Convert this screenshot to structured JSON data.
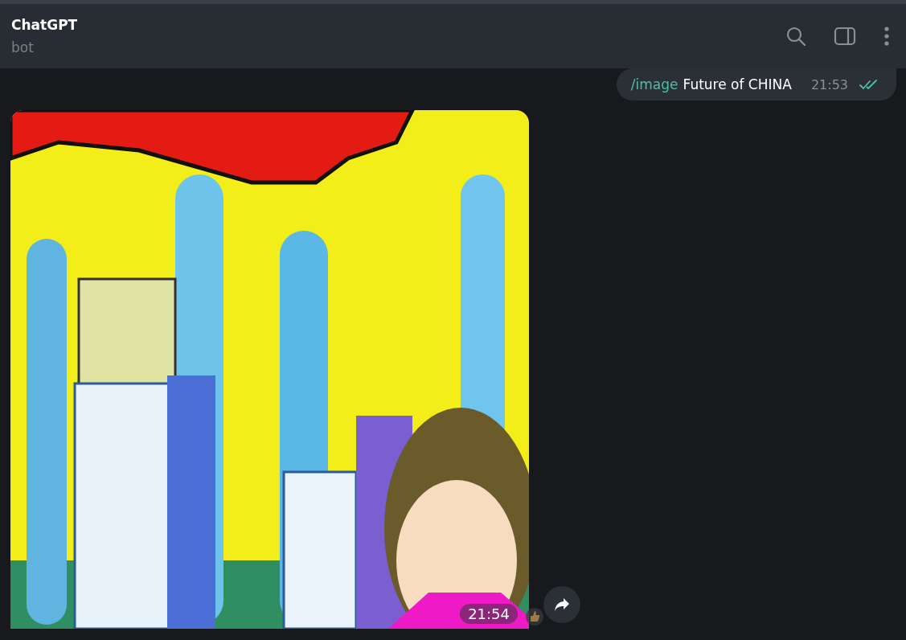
{
  "header": {
    "title": "ChatGPT",
    "subtitle": "bot"
  },
  "messages": [
    {
      "kind": "text",
      "outgoing": true,
      "command": "/image",
      "text": "Future of CHINA",
      "time": "21:53",
      "read": true
    },
    {
      "outgoing": false,
      "time": "21:54",
      "reaction": true
    }
  ]
}
